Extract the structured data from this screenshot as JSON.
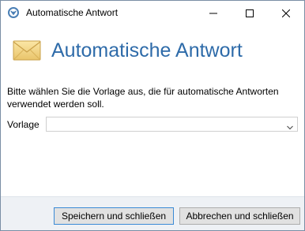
{
  "window": {
    "title": "Automatische Antwort",
    "controls": {
      "minimize": "minimize",
      "maximize": "maximize",
      "close": "close"
    }
  },
  "header": {
    "icon": "envelope-icon",
    "heading": "Automatische Antwort"
  },
  "content": {
    "description": "Bitte wählen Sie die Vorlage aus, die für automatische Antworten verwendet werden soll.",
    "template_label": "Vorlage",
    "template_value": ""
  },
  "footer": {
    "save_label": "Speichern und schließen",
    "cancel_label": "Abbrechen und schließen"
  },
  "colors": {
    "heading": "#2e6ba9",
    "footer_bg": "#eef1f5",
    "button_bg": "#e1e1e1",
    "default_button_border": "#3a8ad6"
  }
}
